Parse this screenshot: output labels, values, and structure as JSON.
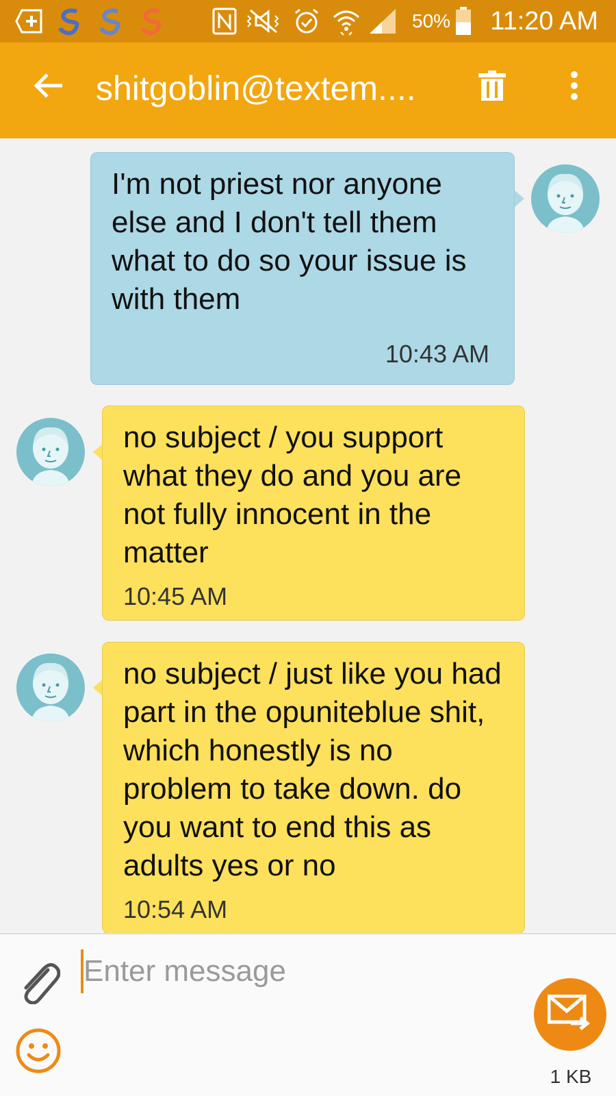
{
  "status_bar": {
    "time": "11:20 AM",
    "battery_percent": "50%",
    "battery_level": 0.5,
    "icons": [
      "add-notification-icon",
      "swirl-app-icon",
      "swirl-app-icon",
      "swirl-app-icon",
      "nfc-icon",
      "mute-icon",
      "alarm-icon",
      "wifi-icon",
      "signal-icon",
      "battery-icon"
    ]
  },
  "app_bar": {
    "title": "shitgoblin@textem....",
    "icons": [
      "back-arrow-icon",
      "trash-icon",
      "more-vert-icon"
    ]
  },
  "messages": [
    {
      "direction": "sent",
      "text": "I'm not priest nor anyone else and I don't tell them what to do so your issue is with them",
      "time": "10:43 AM"
    },
    {
      "direction": "received",
      "text": " no subject / you support what they do and you are not fully innocent in the matter",
      "time": "10:45 AM"
    },
    {
      "direction": "received",
      "text": " no subject / just like you had part in the opuniteblue shit, which honestly is no problem to take down. do you want to end this as adults yes or no",
      "time": "10:54 AM"
    }
  ],
  "compose": {
    "placeholder": "Enter message",
    "value": "",
    "size_label": "1 KB",
    "icons": [
      "paperclip-icon",
      "emoji-icon",
      "send-mms-icon"
    ]
  },
  "colors": {
    "status_bar": "#d98c0b",
    "app_bar": "#f2a60f",
    "sent_bubble": "#add8e6",
    "received_bubble": "#fde05b",
    "avatar": "#7bbfca",
    "accent": "#ee8a14"
  }
}
